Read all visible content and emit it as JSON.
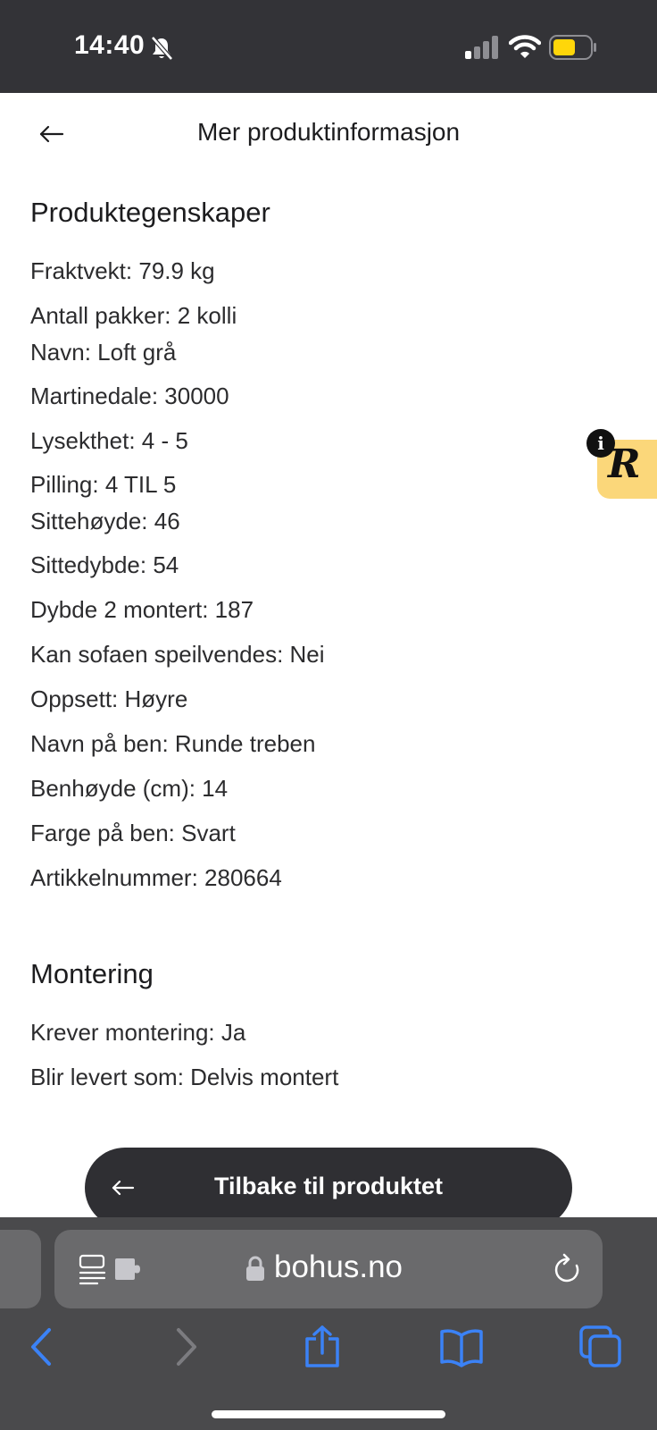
{
  "status_bar": {
    "time": "14:40",
    "icons": [
      "bell-off-icon",
      "signal-icon",
      "wifi-icon",
      "battery-icon"
    ],
    "battery_color": "#ffd60a"
  },
  "header": {
    "title": "Mer produktinformasjon",
    "back_icon": "back-arrow-icon"
  },
  "sections": [
    {
      "heading": "Produktegenskaper",
      "rows": [
        "Fraktvekt: 79.9 kg",
        "Antall pakker: 2 kolli",
        "Navn: Loft grå",
        "Martinedale: 30000",
        "Lysekthet: 4 - 5",
        "Pilling: 4 TIL 5",
        "Sittehøyde: 46",
        "Sittedybde: 54",
        "Dybde 2 montert: 187",
        "Kan sofaen speilvendes: Nei",
        "Oppsett: Høyre",
        "Navn på ben: Runde treben",
        "Benhøyde (cm): 14",
        "Farge på ben: Svart",
        "Artikkelnummer: 280664"
      ]
    },
    {
      "heading": "Montering",
      "rows": [
        "Krever montering: Ja",
        "Blir levert som: Delvis montert"
      ]
    }
  ],
  "review_badge": {
    "letter": "R",
    "info": "i",
    "color": "#fbd77a"
  },
  "back_button": {
    "label": "Tilbake til produktet"
  },
  "browser": {
    "url": "bohus.no",
    "accent": "#3b82f6",
    "toolbar_icons": [
      "back-icon",
      "forward-icon",
      "share-icon",
      "bookmarks-icon",
      "tabs-icon"
    ]
  }
}
